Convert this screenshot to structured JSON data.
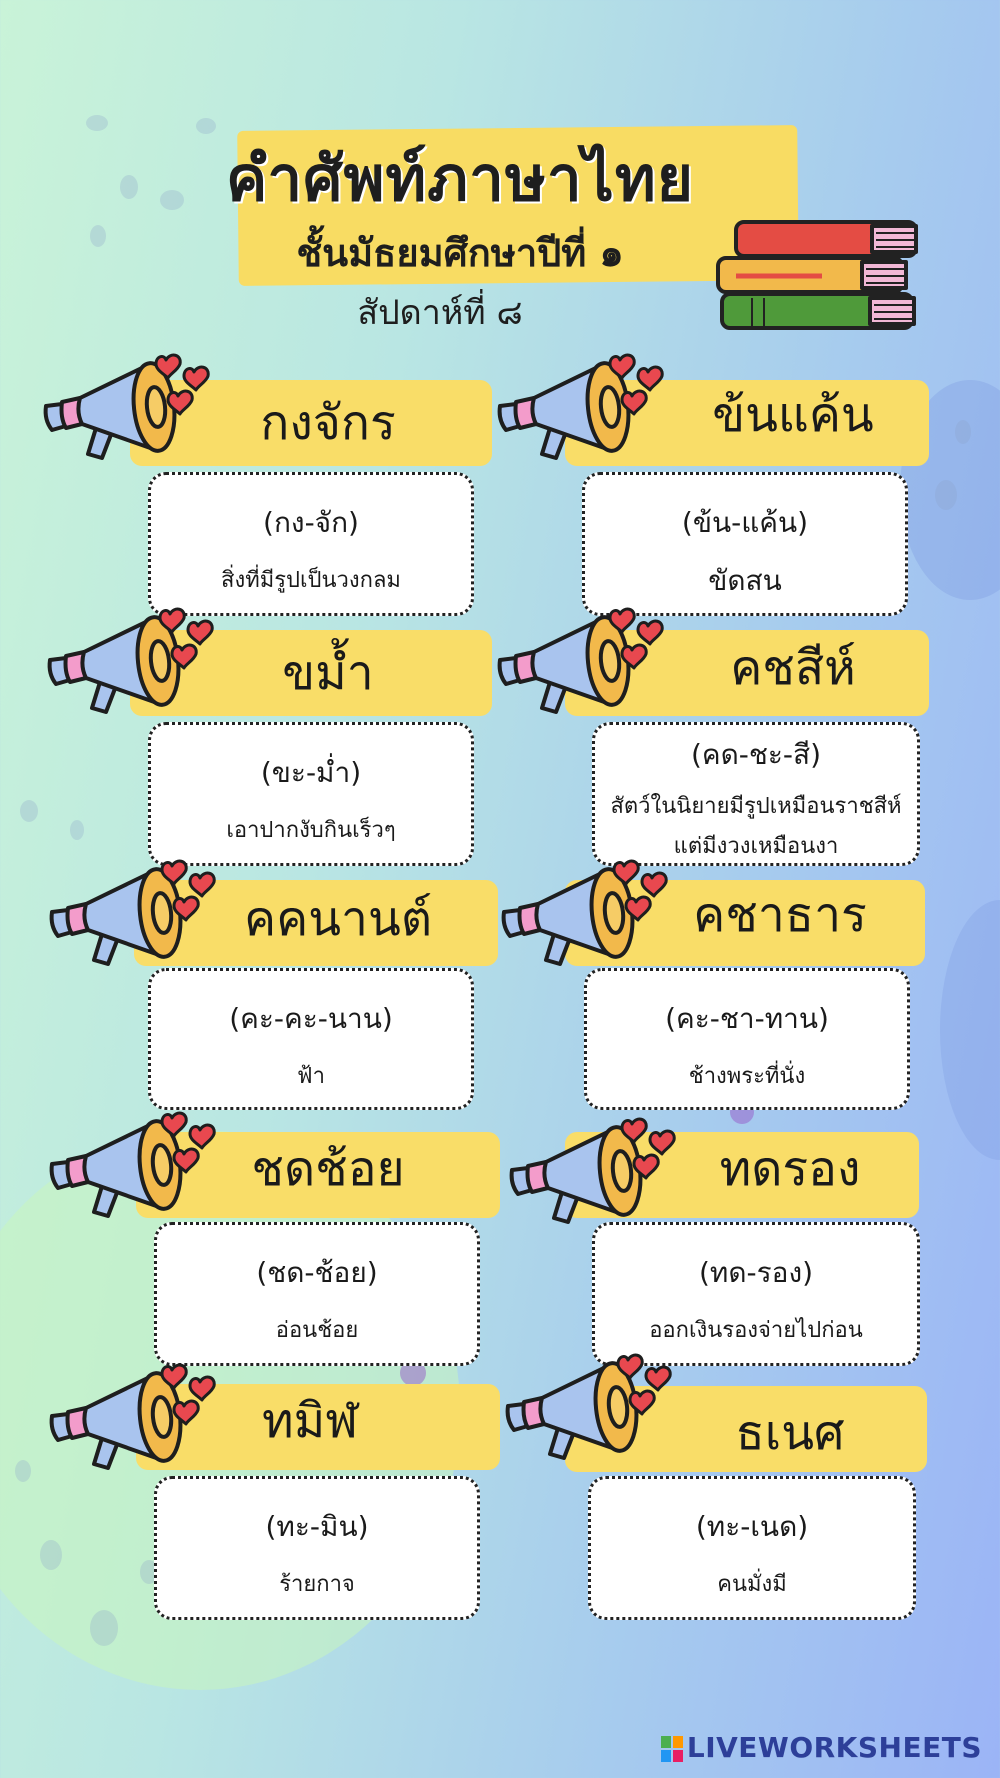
{
  "header": {
    "title": "คำศัพท์ภาษาไทย",
    "subtitle": "ชั้นมัธยมศึกษาปีที่ ๑",
    "week": "สัปดาห์ที่ ๘"
  },
  "cards": [
    {
      "word": "กงจักร",
      "pron": "(กง-จัก)",
      "meaning": "สิ่งที่มีรูปเป็นวงกลม"
    },
    {
      "word": "ข้นแค้น",
      "pron": "(ข้น-แค้น)",
      "meaning": "ขัดสน"
    },
    {
      "word": "ขม้ำ",
      "pron": "(ขะ-ม่ำ)",
      "meaning": "เอาปากงับกินเร็วๆ"
    },
    {
      "word": "คชสีห์",
      "pron": "(คด-ชะ-สี)",
      "meaning": "สัตว์ในนิยายมีรูปเหมือนราชสีห์",
      "meaning2": "แต่มีงวงเหมือนงา"
    },
    {
      "word": "คคนานต์",
      "pron": "(คะ-คะ-นาน)",
      "meaning": "ฟ้า"
    },
    {
      "word": "คชาธาร",
      "pron": "(คะ-ชา-ทาน)",
      "meaning": "ช้างพระที่นั่ง"
    },
    {
      "word": "ชดช้อย",
      "pron": "(ชด-ช้อย)",
      "meaning": "อ่อนช้อย"
    },
    {
      "word": "ทดรอง",
      "pron": "(ทด-รอง)",
      "meaning": "ออกเงินรองจ่ายไปก่อน"
    },
    {
      "word": "ทมิฬ",
      "pron": "(ทะ-มิน)",
      "meaning": "ร้ายกาจ"
    },
    {
      "word": "ธเนศ",
      "pron": "(ทะ-เนด)",
      "meaning": "คนมั่งมี"
    }
  ],
  "icons": {
    "megaphone": "megaphone-icon",
    "hearts": "hearts-icon",
    "books": "books-stack-icon"
  },
  "colors": {
    "highlight": "#f9dd68",
    "megaphone_body": "#a9c4ee",
    "megaphone_cone": "#f2b94b",
    "heart": "#e8484f"
  },
  "footer": {
    "brand": "LIVEWORKSHEETS"
  }
}
